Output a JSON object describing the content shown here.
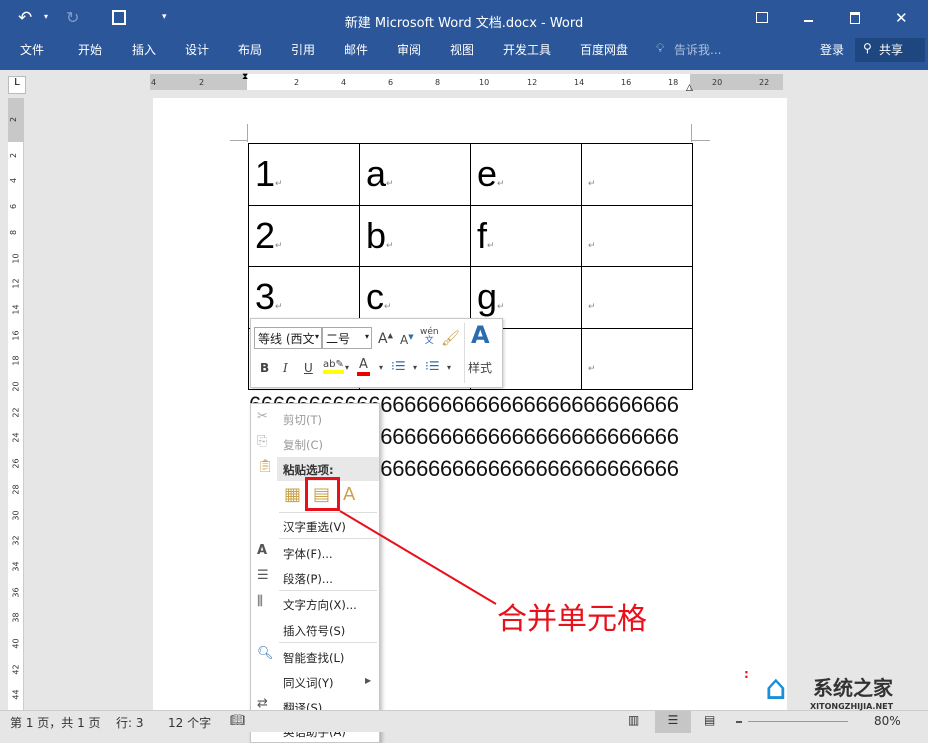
{
  "title": "新建 Microsoft Word 文档.docx - Word",
  "ribbon_tabs": [
    "文件",
    "开始",
    "插入",
    "设计",
    "布局",
    "引用",
    "邮件",
    "审阅",
    "视图",
    "开发工具",
    "百度网盘"
  ],
  "tell_me": "告诉我...",
  "login": "登录",
  "share": "共享",
  "ruler_h": [
    "4",
    "2",
    "2",
    "4",
    "6",
    "8",
    "10",
    "12",
    "14",
    "16",
    "18",
    "20",
    "22"
  ],
  "ruler_v": [
    "2",
    "2",
    "4",
    "6",
    "8",
    "10",
    "12",
    "14",
    "16",
    "18",
    "20",
    "22",
    "24",
    "26",
    "28",
    "30",
    "32",
    "34",
    "36",
    "38",
    "40",
    "42",
    "44"
  ],
  "table": [
    [
      "1",
      "a",
      "e",
      ""
    ],
    [
      "2",
      "b",
      "f",
      ""
    ],
    [
      "3",
      "c",
      "g",
      ""
    ],
    [
      "",
      "",
      "",
      ""
    ]
  ],
  "text_lines": [
    "666666666666666666666666666666666666",
    "666666666666666666666666666666666666",
    "666666666666666666666666666666666666"
  ],
  "mini_toolbar": {
    "font": "等线 (西文",
    "size": "二号",
    "bold": "B",
    "italic": "I",
    "underline": "U",
    "styles": "样式",
    "phonetic": "wén"
  },
  "context_menu": {
    "cut": "剪切(T)",
    "copy": "复制(C)",
    "paste_header": "粘贴选项:",
    "reconvert": "汉字重选(V)",
    "font": "字体(F)...",
    "paragraph": "段落(P)...",
    "text_direction": "文字方向(X)...",
    "insert_symbol": "插入符号(S)",
    "smart_lookup": "智能查找(L)",
    "synonyms": "同义词(Y)",
    "translate": "翻译(S)",
    "english_assistant": "英语助手(A)"
  },
  "annotation": "合并单元格",
  "annotation_color": "#e8101a",
  "status": {
    "page": "第 1 页，共 1 页",
    "line": "行: 3",
    "words": "12 个字",
    "zoom": "80%"
  },
  "watermark": {
    "name": "系统之家",
    "url": "XITONGZHIJIA.NET"
  }
}
